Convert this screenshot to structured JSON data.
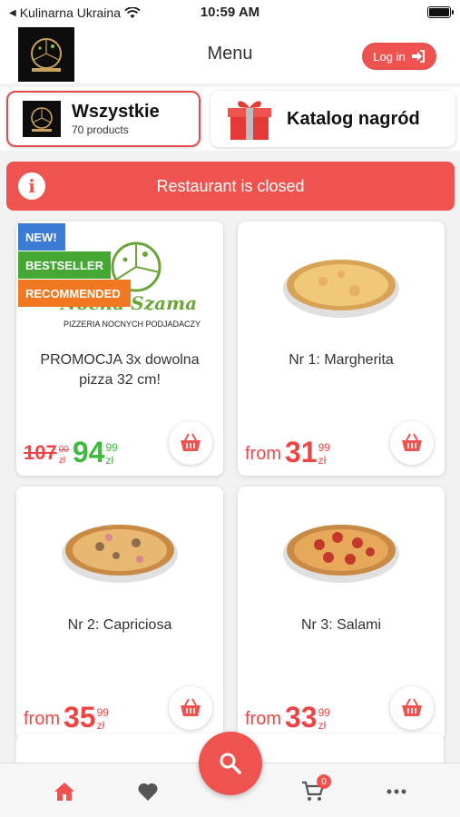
{
  "status_bar": {
    "back_app": "Kulinarna Ukraina",
    "time": "10:59 AM"
  },
  "header": {
    "title": "Menu",
    "login_label": "Log in"
  },
  "categories": [
    {
      "name": "Wszystkie",
      "count_label": "70 products",
      "selected": true
    },
    {
      "name": "Katalog nagród"
    }
  ],
  "banner": {
    "text": "Restaurant is closed"
  },
  "products": [
    {
      "name": "PROMOCJA 3x dowolna pizza 32 cm!",
      "old_price_int": "107",
      "old_price_dec": "00",
      "old_price_cur": "zł",
      "price_int": "94",
      "price_dec": "99",
      "currency": "zł",
      "badges": [
        "NEW!",
        "BESTSELLER",
        "RECOMMENDED"
      ],
      "brand_lines": [
        "Nocna Szama",
        "PIZZERIA NOCNYCH PODJADACZY"
      ]
    },
    {
      "name": "Nr 1: Margherita",
      "from_label": "from",
      "price_int": "31",
      "price_dec": "99",
      "currency": "zł"
    },
    {
      "name": "Nr 2: Capriciosa",
      "from_label": "from",
      "price_int": "35",
      "price_dec": "99",
      "currency": "zł"
    },
    {
      "name": "Nr 3: Salami",
      "from_label": "from",
      "price_int": "33",
      "price_dec": "99",
      "currency": "zł"
    }
  ],
  "nav": {
    "cart_count": "0",
    "items": [
      "home-icon",
      "heart-icon",
      "search-icon",
      "cart-icon",
      "more-icon"
    ]
  },
  "colors": {
    "accent": "#ef5350",
    "green_price": "#3fb93f",
    "badge_new": "#3a7bd5",
    "badge_bestseller": "#44a832",
    "badge_recommended": "#f07820"
  }
}
